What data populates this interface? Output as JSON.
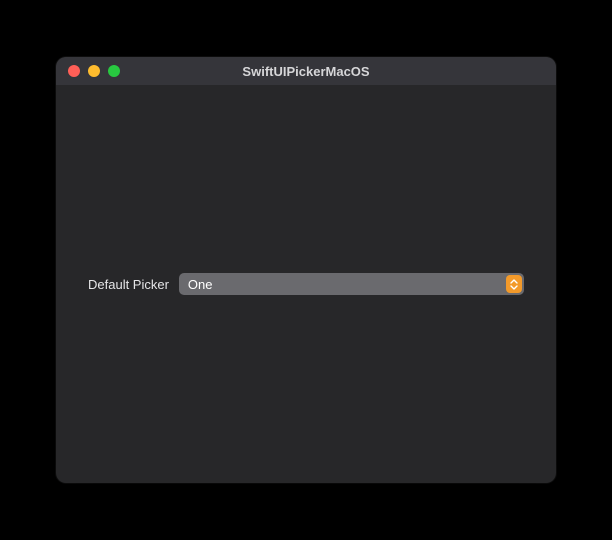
{
  "window": {
    "title": "SwiftUIPickerMacOS"
  },
  "form": {
    "picker_label": "Default Picker",
    "picker_value": "One"
  },
  "colors": {
    "accent": "#f39a2a",
    "window_bg": "#272729",
    "titlebar_bg": "#35353a"
  }
}
